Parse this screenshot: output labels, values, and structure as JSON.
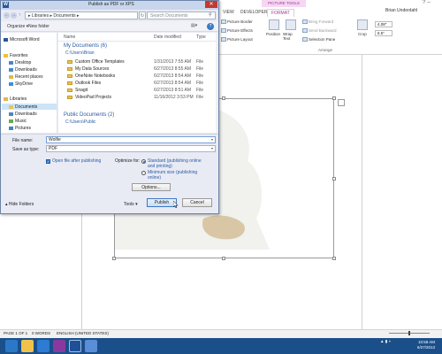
{
  "word": {
    "ribbon": {
      "picture_tools_label": "PICTURE TOOLS",
      "tabs": [
        "VIEW",
        "DEVELOPER",
        "FORMAT"
      ],
      "user_name": "Brian Underdahl",
      "items": {
        "picture_border": "Picture Border",
        "picture_effects": "Picture Effects",
        "picture_layout": "Picture Layout",
        "position": "Position",
        "wrap_text": "Wrap Text",
        "bring_forward": "Bring Forward",
        "send_backward": "Send Backward",
        "selection_pane": "Selection Pane",
        "crop": "Crop",
        "arrange_label": "Arrange",
        "height_value": "4.08\"",
        "width_value": "6.5\""
      }
    },
    "status": {
      "page": "PAGE 1 OF 1",
      "words": "0 WORDS",
      "language": "ENGLISH (UNITED STATES)"
    },
    "taskbar": {
      "time": "10:58 AM",
      "date": "6/27/2013"
    }
  },
  "dialog": {
    "title": "Publish as PDF or XPS",
    "address": "▸ Libraries ▸ Documents ▸",
    "search_placeholder": "Search Documents",
    "toolbar": {
      "organize": "Organize ▾",
      "new_folder": "New folder"
    },
    "nav": {
      "app": "Microsoft Word",
      "favorites": "Favorites",
      "desktop": "Desktop",
      "downloads": "Downloads",
      "recent_places": "Recent places",
      "skydrive": "SkyDrive",
      "libraries": "Libraries",
      "documents": "Documents",
      "lib_downloads": "Downloads",
      "music": "Music",
      "pictures": "Pictures"
    },
    "columns": {
      "name": "Name",
      "date": "Date modified",
      "type": "Type"
    },
    "groups": [
      {
        "title": "My Documents (6)",
        "path": "C:\\Users\\Brian",
        "files": [
          {
            "name": "Custom Office Templates",
            "date": "1/31/2013 7:55 AM",
            "type": "File"
          },
          {
            "name": "My Data Sources",
            "date": "6/27/2013 8:55 AM",
            "type": "File"
          },
          {
            "name": "OneNote Notebooks",
            "date": "6/27/2013 8:54 AM",
            "type": "File"
          },
          {
            "name": "Outlook Files",
            "date": "6/27/2013 8:54 AM",
            "type": "File"
          },
          {
            "name": "Snagit",
            "date": "6/27/2013 8:51 AM",
            "type": "File"
          },
          {
            "name": "VideoPad Projects",
            "date": "11/16/2012 3:53 PM",
            "type": "File"
          }
        ]
      },
      {
        "title": "Public Documents (2)",
        "path": "C:\\Users\\Public",
        "files": []
      }
    ],
    "form": {
      "filename_label": "File name:",
      "filename_value": "Wolfie",
      "savetype_label": "Save as type:",
      "savetype_value": "PDF",
      "open_after_label": "Open file after publishing",
      "optimize_label": "Optimize for:",
      "standard_label": "Standard (publishing online and printing)",
      "minimum_label": "Minimum size (publishing online)",
      "options_button": "Options..."
    },
    "footer": {
      "hide_folders": "Hide Folders",
      "tools": "Tools",
      "publish": "Publish",
      "cancel": "Cancel"
    }
  }
}
